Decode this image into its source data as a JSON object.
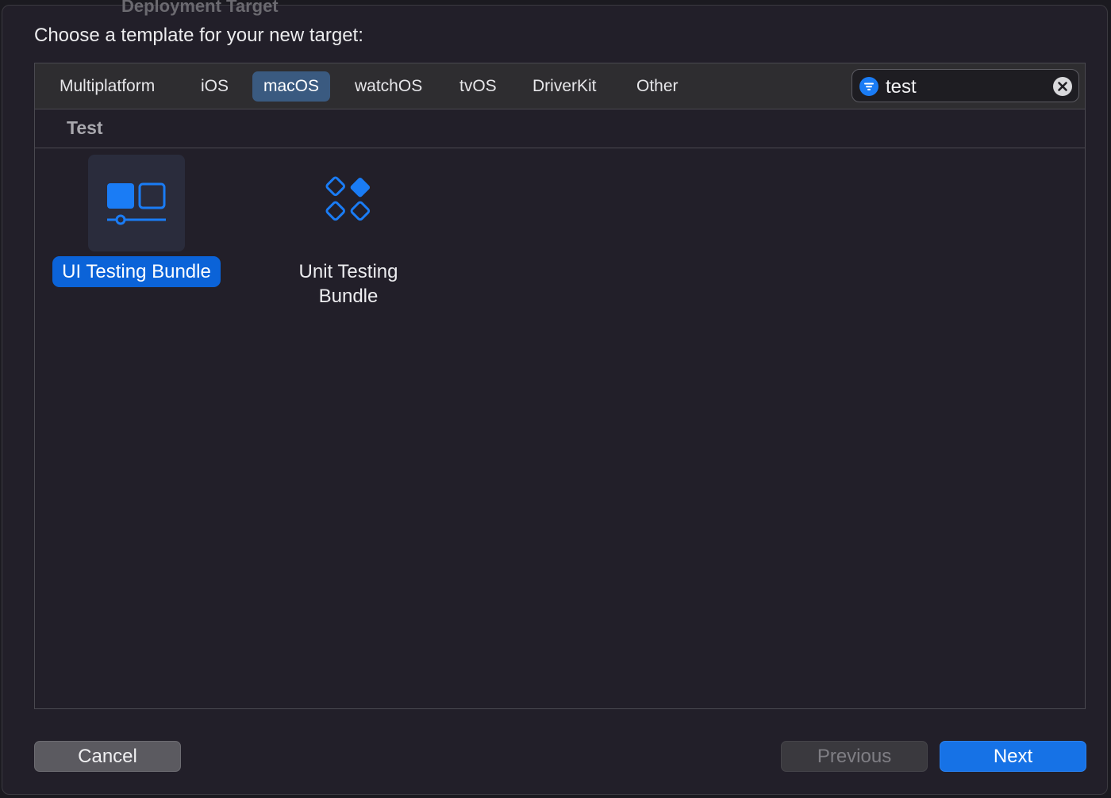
{
  "dialog": {
    "prompt": "Choose a template for your new target:",
    "backdrop_text": "Deployment Target"
  },
  "tabs": [
    {
      "label": "Multiplatform",
      "active": false
    },
    {
      "label": "iOS",
      "active": false
    },
    {
      "label": "macOS",
      "active": true
    },
    {
      "label": "watchOS",
      "active": false
    },
    {
      "label": "tvOS",
      "active": false
    },
    {
      "label": "DriverKit",
      "active": false
    },
    {
      "label": "Other",
      "active": false
    }
  ],
  "search": {
    "value": "test",
    "icon": "filter-icon",
    "clear_icon": "clear-icon"
  },
  "section": {
    "title": "Test"
  },
  "templates": [
    {
      "label": "UI Testing Bundle",
      "icon": "ui-testing-bundle-icon",
      "selected": true
    },
    {
      "label": "Unit Testing Bundle",
      "icon": "unit-testing-bundle-icon",
      "selected": false
    }
  ],
  "buttons": {
    "cancel": "Cancel",
    "previous": "Previous",
    "next": "Next"
  },
  "colors": {
    "accent": "#1672e6",
    "selection": "#0b63d8",
    "active_tab": "#3a5a80",
    "icon_blue": "#1a7cf5"
  }
}
